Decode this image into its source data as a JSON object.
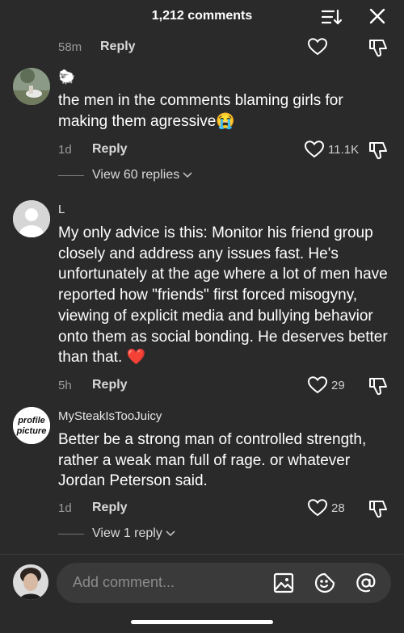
{
  "header": {
    "title": "1,212 comments",
    "sort_icon": "sort-icon",
    "close_icon": "close-icon"
  },
  "top_meta": {
    "time": "58m",
    "reply": "Reply"
  },
  "comments": [
    {
      "username": "🐑",
      "text": "the men in the comments blaming girls for making them agressive😭",
      "time": "1d",
      "reply": "Reply",
      "likes": "11.1K",
      "view_replies": "View 60 replies"
    },
    {
      "username": "L",
      "text": "My only advice is this: Monitor his friend group closely and address any issues fast. He's unfortunately at the age where a lot of men have reported how \"friends\" first forced misogyny, viewing of explicit media and bullying behavior onto them as social bonding. He deserves better than that. ❤️",
      "time": "5h",
      "reply": "Reply",
      "likes": "29"
    },
    {
      "username": "MySteakIsTooJuicy",
      "avatar_text": "profile picture",
      "text": "Better be a strong man of controlled strength, rather a weak man full of rage. or whatever Jordan Peterson said.",
      "time": "1d",
      "reply": "Reply",
      "likes": "28",
      "view_replies": "View 1 reply"
    }
  ],
  "composer": {
    "placeholder": "Add comment...",
    "icons": [
      "image-icon",
      "emoji-icon",
      "mention-icon"
    ]
  },
  "colors": {
    "background": "#2a2a2a",
    "text_muted": "#9a9a9a",
    "input_bg": "#3a3a3a"
  }
}
